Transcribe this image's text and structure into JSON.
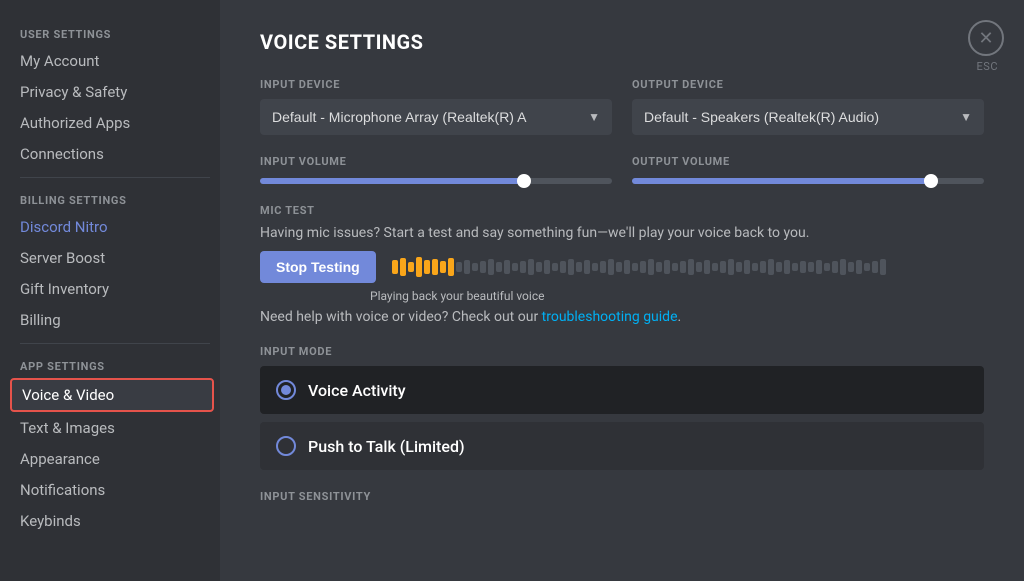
{
  "sidebar": {
    "user_settings_label": "USER SETTINGS",
    "billing_settings_label": "BILLING SETTINGS",
    "app_settings_label": "APP SETTINGS",
    "items": {
      "my_account": "My Account",
      "privacy_safety": "Privacy & Safety",
      "authorized_apps": "Authorized Apps",
      "connections": "Connections",
      "discord_nitro": "Discord Nitro",
      "server_boost": "Server Boost",
      "gift_inventory": "Gift Inventory",
      "billing": "Billing",
      "voice_video": "Voice & Video",
      "text_images": "Text & Images",
      "appearance": "Appearance",
      "notifications": "Notifications",
      "keybinds": "Keybinds"
    }
  },
  "main": {
    "title": "VOICE SETTINGS",
    "input_device_label": "INPUT DEVICE",
    "output_device_label": "OUTPUT DEVICE",
    "input_device_value": "Default - Microphone Array (Realtek(R) A",
    "output_device_value": "Default - Speakers (Realtek(R) Audio)",
    "input_volume_label": "INPUT VOLUME",
    "output_volume_label": "OUTPUT VOLUME",
    "mic_test_label": "MIC TEST",
    "mic_test_desc": "Having mic issues? Start a test and say something fun—we'll play your voice back to you.",
    "stop_testing_btn": "Stop Testing",
    "playing_back_text": "Playing back your beautiful voice",
    "troubleshoot_text": "Need help with voice or video? Check out our ",
    "troubleshoot_link": "troubleshooting guide",
    "input_mode_label": "INPUT MODE",
    "voice_activity_label": "Voice Activity",
    "push_to_talk_label": "Push to Talk (Limited)",
    "input_sensitivity_label": "INPUT SENSITIVITY",
    "close_btn_icon": "✕",
    "esc_label": "ESC"
  }
}
